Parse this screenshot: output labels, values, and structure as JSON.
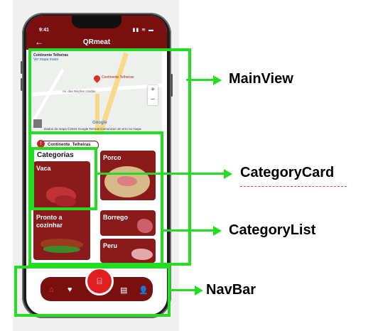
{
  "status_bar": {
    "time": "9:41",
    "icons": "▮▮ ≋ ▬"
  },
  "app_bar": {
    "back": "←",
    "title": "QRmeat"
  },
  "map": {
    "place_title": "Continente Telheiras",
    "view_larger": "Ver mapa maior",
    "pin_label": "Continente Telheiras",
    "street": "Av. das Nações Unidas",
    "brand": "Google",
    "footer": "Dados do mapa ©2024 Google   Termos   Comunicar um erro no mapa",
    "zoom_in": "+",
    "zoom_out": "−"
  },
  "location_chip": {
    "icon": "!",
    "label": "Continente_Telheiras"
  },
  "categories": {
    "title": "Categorias",
    "items": [
      {
        "label": "Vaca"
      },
      {
        "label": "Porco"
      },
      {
        "label": "Pronto a cozinhar"
      },
      {
        "label": "Borrego"
      },
      {
        "label": "Peru"
      }
    ]
  },
  "navbar": {
    "home": "⌂",
    "favorites": "♥",
    "scan": "⌸",
    "news": "▤",
    "profile": "👤"
  },
  "annotations": {
    "main_view": "MainView",
    "category_card": "CategoryCard",
    "category_list": "CategoryList",
    "nav_bar": "NavBar",
    "box_color": "#22dd22"
  },
  "colors": {
    "primary": "#7a0f0f",
    "accent": "#e02020",
    "card": "#8b1a1a"
  }
}
